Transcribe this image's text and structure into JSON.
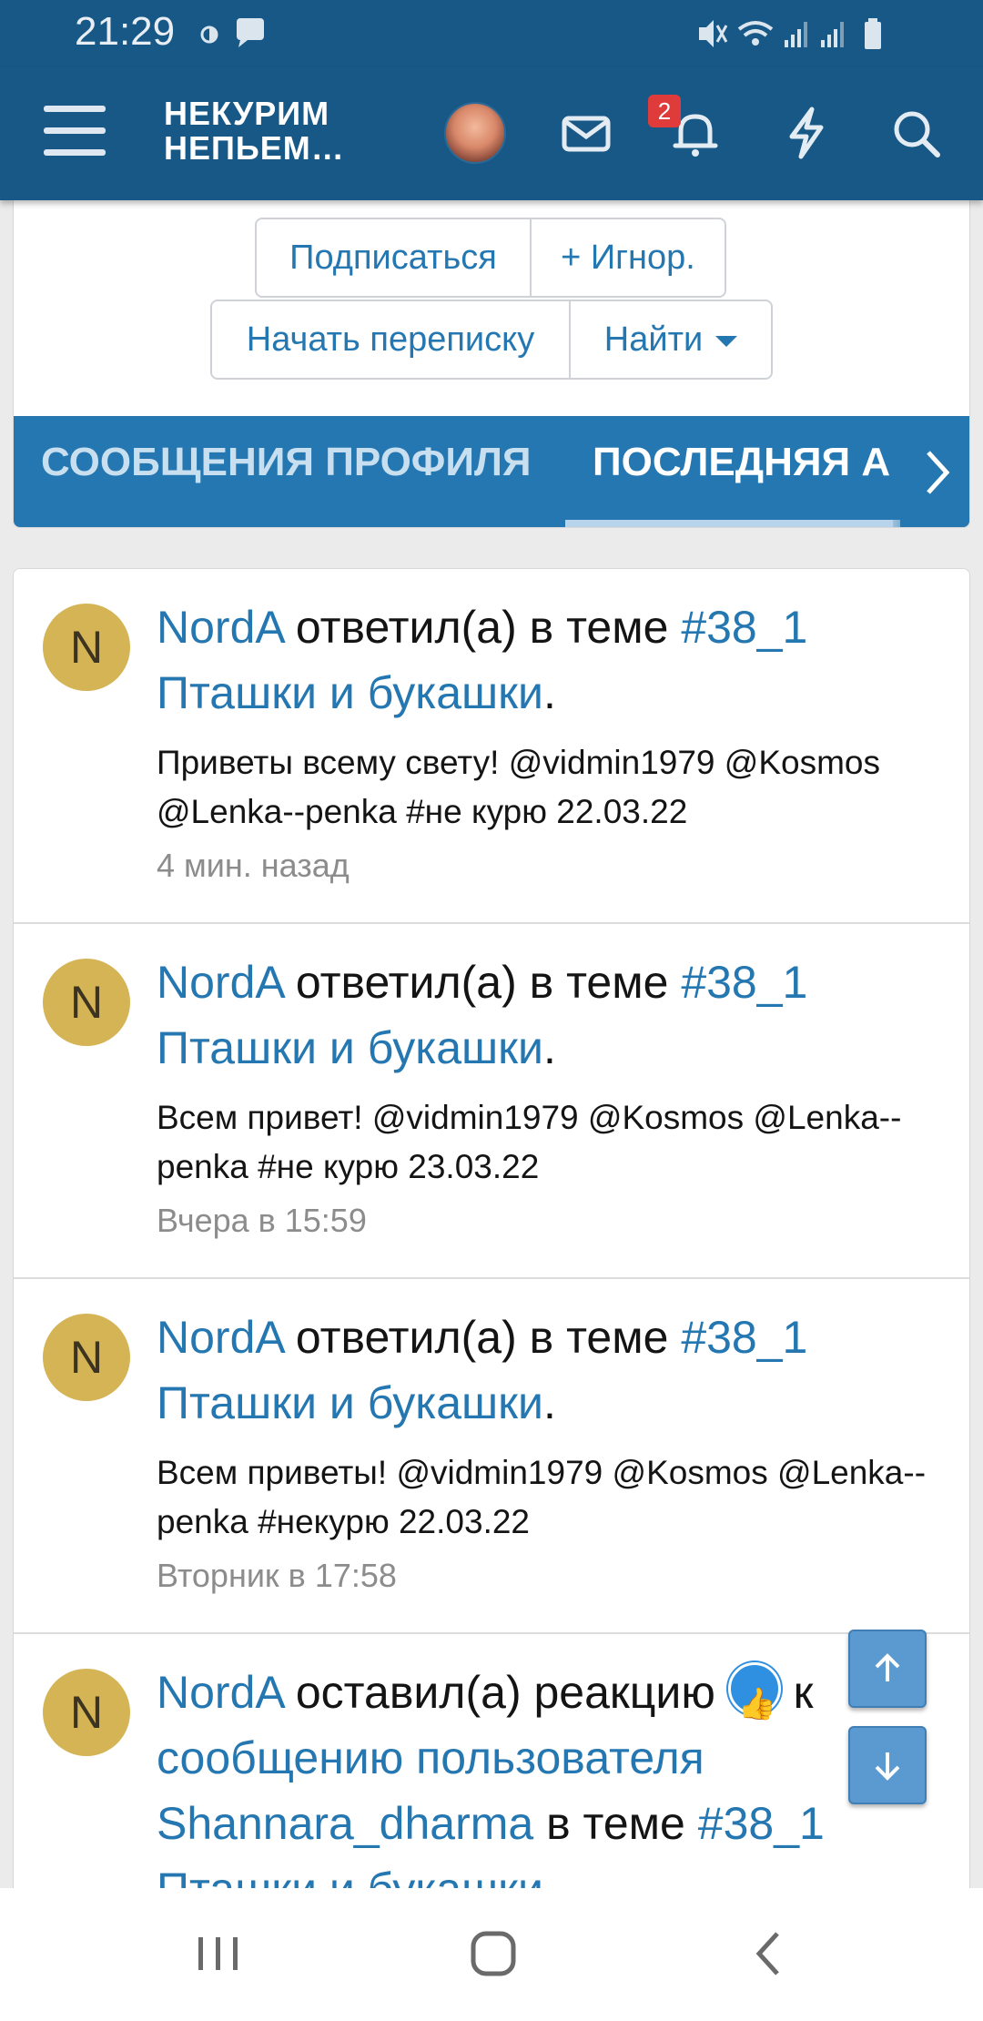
{
  "status_bar": {
    "time": "21:29"
  },
  "header": {
    "logo_line1": "НЕКУРИМ",
    "logo_line2": "НЕПЬЕМ…",
    "notification_count": "2",
    "icons": [
      "menu-icon",
      "avatar",
      "mail-icon",
      "bell-icon",
      "bolt-icon",
      "search-icon"
    ]
  },
  "profile_actions": {
    "subscribe": "Подписаться",
    "ignore": "+ Игнор.",
    "start_conversation": "Начать переписку",
    "find": "Найти"
  },
  "tabs": {
    "profile_posts": "СООБЩЕНИЯ ПРОФИЛЯ",
    "latest_activity": "ПОСЛЕДНЯЯ АКТИВНОСТЬ"
  },
  "feed": [
    {
      "avatar_letter": "N",
      "user": "NordA",
      "action": " ответил(а) в теме ",
      "thread_tag": "#38_1",
      "thread_title": "Пташки и букашки",
      "end": ".",
      "snippet": "Приветы всему свету! @vidmin1979 @Kosmos @Lenka--penka #не курю 22.03.22",
      "time": "4 мин. назад"
    },
    {
      "avatar_letter": "N",
      "user": "NordA",
      "action": " ответил(а) в теме ",
      "thread_tag": "#38_1",
      "thread_title": "Пташки и букашки",
      "end": ".",
      "snippet": "Всем привет! @vidmin1979 @Kosmos @Lenka--penka #не курю 23.03.22",
      "time": "Вчера в 15:59"
    },
    {
      "avatar_letter": "N",
      "user": "NordA",
      "action": " ответил(а) в теме ",
      "thread_tag": "#38_1",
      "thread_title": "Пташки и букашки",
      "end": ".",
      "snippet": "Всем приветы! @vidmin1979 @Kosmos @Lenka--penka #некурю 22.03.22",
      "time": "Вторник в 17:58"
    },
    {
      "avatar_letter": "N",
      "user": "NordA",
      "action": " оставил(а) реакцию ",
      "after_reaction": " к ",
      "link_text": "сообщению пользователя Shannara_dharma",
      "mid": " в теме ",
      "thread_tag": "#38_1",
      "thread_title": "Пташки и букашки"
    }
  ],
  "colors": {
    "header_bg": "#185886",
    "accent": "#2577b1",
    "avatar_bg": "#d4b455",
    "badge": "#e03b3b"
  }
}
